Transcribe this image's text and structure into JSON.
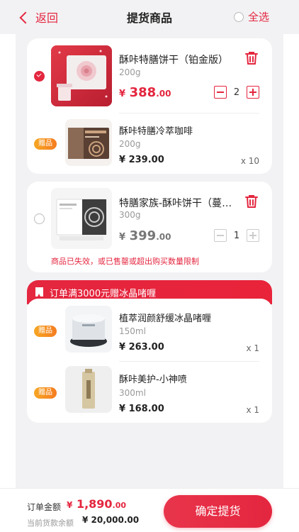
{
  "header": {
    "back_label": "返回",
    "title": "提货商品",
    "select_all_label": "全选"
  },
  "cart": [
    {
      "name": "酥咔特膳饼干（铂金版）",
      "spec": "200g",
      "price_currency": "¥",
      "price_int": "388",
      "price_dec": ".00",
      "quantity": "2",
      "selected": true
    },
    {
      "tag": "赠品",
      "name": "酥咔特膳冷萃咖啡",
      "spec": "200g",
      "price": "¥ 239.00",
      "qty": "x 10"
    },
    {
      "name": "特膳家族-酥咔饼干（蔓越莓味）",
      "spec": "300g",
      "price_currency": "¥",
      "price_int": "399",
      "price_dec": ".00",
      "quantity": "1",
      "invalid_message": "商品已失效，或已售罄或超出购买数量限制"
    }
  ],
  "promo": {
    "title": "订单满3000元赠冰晶啫喱",
    "items": [
      {
        "tag": "赠品",
        "name": "植萃润颜舒缓冰晶啫喱",
        "spec": "150ml",
        "price": "¥ 263.00",
        "qty": "x 1"
      },
      {
        "tag": "赠品",
        "name": "酥咔美护-小神喷",
        "spec": "300ml",
        "price": "¥ 168.00",
        "qty": "x 1"
      }
    ]
  },
  "footer": {
    "order_total_label": "订单金额",
    "order_total_currency": "¥",
    "order_total_int": "1,890",
    "order_total_dec": ".00",
    "balance_label": "当前货款余额",
    "balance_value": "¥ 20,000.00",
    "confirm_label": "确定提货"
  },
  "colors": {
    "accent": "#e4263f",
    "gift_tag": "#f6a623",
    "background": "#f2f2f4"
  }
}
